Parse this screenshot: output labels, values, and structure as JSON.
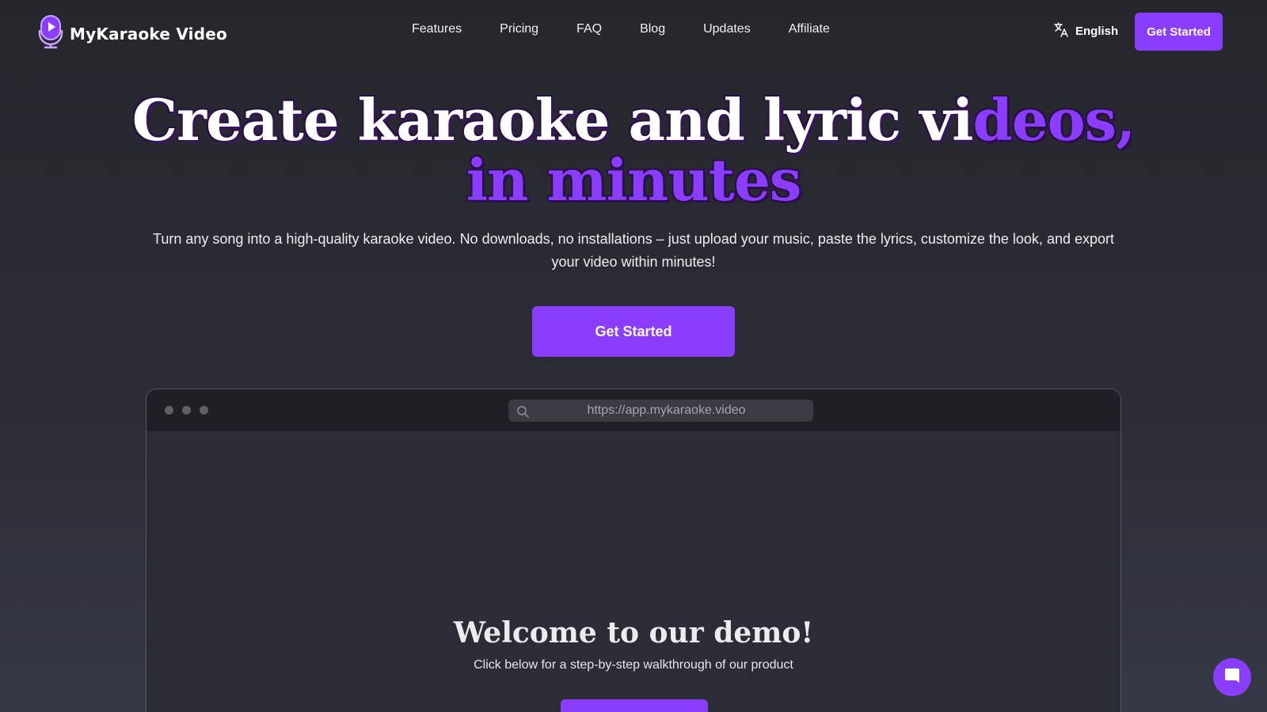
{
  "brand": {
    "name": "MyKaraoke Video",
    "logo_icon": "microphone-play-icon"
  },
  "nav": {
    "links": [
      "Features",
      "Pricing",
      "FAQ",
      "Blog",
      "Updates",
      "Affiliate"
    ],
    "language": {
      "icon": "translate-icon",
      "label": "English"
    },
    "cta_label": "Get Started"
  },
  "hero": {
    "title_line1_white": "Create karaoke and lyric vi",
    "title_line1_purple": "deos,",
    "title_line2_purple": "in minutes",
    "subtitle": "Turn any song into a high-quality karaoke video. No downloads, no installations – just upload your music, paste the lyrics, customize the look, and export your video within minutes!",
    "cta_label": "Get Started"
  },
  "demo": {
    "url": "https://app.mykaraoke.video",
    "url_icon": "search-icon",
    "title": "Welcome to our demo!",
    "subtitle": "Click below for a step-by-step walkthrough of our product"
  },
  "chat": {
    "icon": "chat-bubble-icon"
  },
  "colors": {
    "accent": "#8b3dff",
    "background": "#26272d",
    "browser_bar": "#1f2026"
  }
}
